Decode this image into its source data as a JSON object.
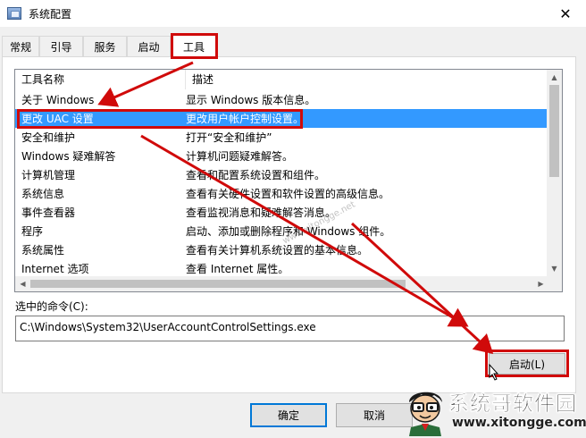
{
  "window": {
    "title": "系统配置",
    "close_glyph": "✕"
  },
  "tabs": [
    {
      "label": "常规",
      "active": false
    },
    {
      "label": "引导",
      "active": false
    },
    {
      "label": "服务",
      "active": false
    },
    {
      "label": "启动",
      "active": false
    },
    {
      "label": "工具",
      "active": true
    }
  ],
  "tools_list": {
    "columns": [
      "工具名称",
      "描述"
    ],
    "rows": [
      {
        "name": "关于 Windows",
        "desc": "显示 Windows 版本信息。"
      },
      {
        "name": "更改 UAC 设置",
        "desc": "更改用户帐户控制设置。",
        "selected": true
      },
      {
        "name": "安全和维护",
        "desc": "打开“安全和维护”"
      },
      {
        "name": "Windows 疑难解答",
        "desc": "计算机问题疑难解答。"
      },
      {
        "name": "计算机管理",
        "desc": "查看和配置系统设置和组件。"
      },
      {
        "name": "系统信息",
        "desc": "查看有关硬件设置和软件设置的高级信息。"
      },
      {
        "name": "事件查看器",
        "desc": "查看监视消息和疑难解答消息。"
      },
      {
        "name": "程序",
        "desc": "启动、添加或删除程序和 Windows 组件。"
      },
      {
        "name": "系统属性",
        "desc": "查看有关计算机系统设置的基本信息。"
      },
      {
        "name": "Internet 选项",
        "desc": "查看 Internet 属性。"
      }
    ]
  },
  "selected_command": {
    "label": "选中的命令(C):",
    "value": "C:\\Windows\\System32\\UserAccountControlSettings.exe"
  },
  "buttons": {
    "launch": "启动(L)",
    "ok": "确定",
    "cancel": "取消"
  },
  "annotation_color": "#d00a0a",
  "selection_color": "#3399ff",
  "watermark": {
    "text": "www.xitongge.net",
    "brand": "系统哥软件园",
    "url": "www.xitongge.com"
  }
}
